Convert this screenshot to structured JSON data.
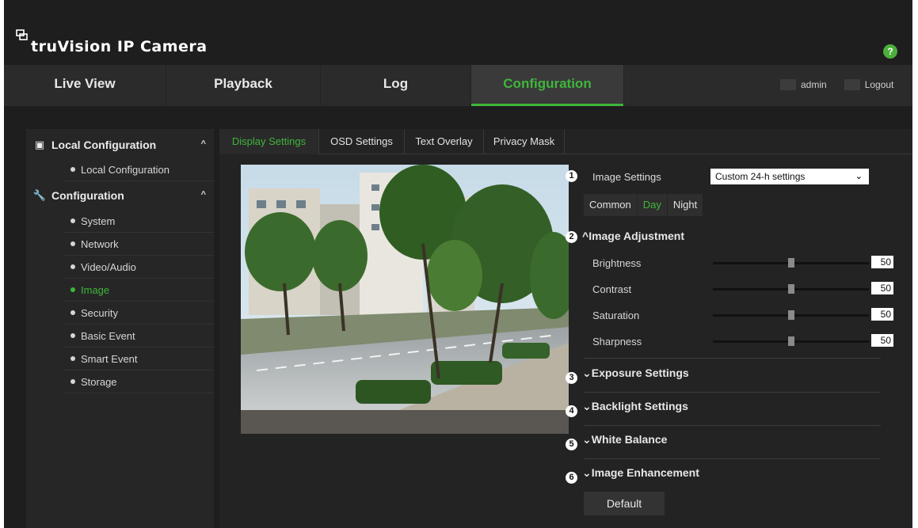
{
  "app": {
    "title": "truVision IP Camera",
    "logo_icon": "camera-logo-icon",
    "help_label": "?"
  },
  "nav": {
    "tabs": [
      {
        "label": "Live View",
        "active": false
      },
      {
        "label": "Playback",
        "active": false
      },
      {
        "label": "Log",
        "active": false
      },
      {
        "label": "Configuration",
        "active": true
      }
    ],
    "user": "admin",
    "logout": "Logout"
  },
  "sidebar": {
    "groups": [
      {
        "label": "Local Configuration",
        "icon": "local-config-icon",
        "expanded": true,
        "items": [
          {
            "label": "Local Configuration",
            "active": false
          }
        ]
      },
      {
        "label": "Configuration",
        "icon": "wrench-icon",
        "expanded": true,
        "items": [
          {
            "label": "System",
            "active": false
          },
          {
            "label": "Network",
            "active": false
          },
          {
            "label": "Video/Audio",
            "active": false
          },
          {
            "label": "Image",
            "active": true
          },
          {
            "label": "Security",
            "active": false
          },
          {
            "label": "Basic Event",
            "active": false
          },
          {
            "label": "Smart Event",
            "active": false
          },
          {
            "label": "Storage",
            "active": false
          }
        ]
      }
    ]
  },
  "subtabs": [
    {
      "label": "Display Settings",
      "active": true
    },
    {
      "label": "OSD Settings",
      "active": false
    },
    {
      "label": "Text Overlay",
      "active": false
    },
    {
      "label": "Privacy Mask",
      "active": false
    }
  ],
  "panel": {
    "callouts": [
      "1",
      "2",
      "3",
      "4",
      "5",
      "6"
    ],
    "image_settings_label": "Image Settings",
    "image_settings_value": "Custom 24-h settings",
    "mode_tabs": [
      {
        "label": "Common",
        "active": false
      },
      {
        "label": "Day",
        "active": true
      },
      {
        "label": "Night",
        "active": false
      }
    ],
    "image_adjustment_title": "Image Adjustment",
    "sliders": [
      {
        "label": "Brightness",
        "value": "50",
        "level": 0.5
      },
      {
        "label": "Contrast",
        "value": "50",
        "level": 0.5
      },
      {
        "label": "Saturation",
        "value": "50",
        "level": 0.5
      },
      {
        "label": "Sharpness",
        "value": "50",
        "level": 0.5
      }
    ],
    "collapsed_sections": [
      "Exposure Settings",
      "Backlight Settings",
      "White Balance",
      "Image Enhancement"
    ],
    "default_button": "Default"
  },
  "colors": {
    "accent": "#3fb63a",
    "background": "#1e1e1e"
  }
}
